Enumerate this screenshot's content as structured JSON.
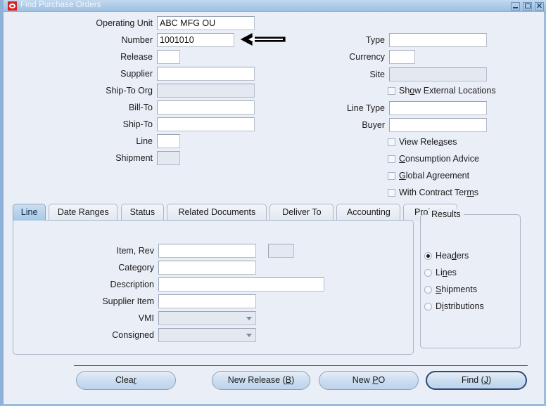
{
  "window": {
    "title": "Find Purchase Orders",
    "logo_icon": "oracle-logo-icon",
    "controls": {
      "minimize": "minimize-icon",
      "maximize": "maximize-icon",
      "close": "close-icon"
    }
  },
  "header_left_fields": [
    {
      "label": "Operating Unit",
      "value": "ABC MFG OU",
      "state": "enabled",
      "size": "wide"
    },
    {
      "label": "Number",
      "value": "1001010",
      "state": "enabled",
      "size": "medium"
    },
    {
      "label": "Release",
      "value": "",
      "state": "enabled",
      "size": "tiny"
    },
    {
      "label": "Supplier",
      "value": "",
      "state": "enabled",
      "size": "wide"
    },
    {
      "label": "Ship-To Org",
      "value": "",
      "state": "disabled",
      "size": "wide"
    },
    {
      "label": "Bill-To",
      "value": "",
      "state": "enabled",
      "size": "wide"
    },
    {
      "label": "Ship-To",
      "value": "",
      "state": "enabled",
      "size": "wide"
    },
    {
      "label": "Line",
      "value": "",
      "state": "enabled",
      "size": "tiny"
    },
    {
      "label": "Shipment",
      "value": "",
      "state": "disabled",
      "size": "tiny"
    }
  ],
  "header_right_fields": [
    {
      "label": "Type",
      "value": "",
      "state": "enabled",
      "size": "wide"
    },
    {
      "label": "Currency",
      "value": "",
      "state": "enabled",
      "size": "tiny"
    },
    {
      "label": "Site",
      "value": "",
      "state": "disabled",
      "size": "wide"
    },
    {
      "label": "Line Type",
      "value": "",
      "state": "enabled",
      "size": "wide"
    },
    {
      "label": "Buyer",
      "value": "",
      "state": "enabled",
      "size": "wide"
    }
  ],
  "header_checkboxes": [
    {
      "label_pre": "Sh",
      "accel": "o",
      "label_post": "w External Locations",
      "checked": false
    },
    {
      "label_pre": "View Rele",
      "accel": "a",
      "label_post": "ses",
      "checked": false
    },
    {
      "label_pre": "",
      "accel": "C",
      "label_post": "onsumption Advice",
      "checked": false
    },
    {
      "label_pre": "",
      "accel": "G",
      "label_post": "lobal Agreement",
      "checked": false
    },
    {
      "label_pre": "With Contract Ter",
      "accel": "m",
      "label_post": "s",
      "checked": false
    }
  ],
  "tabs": [
    {
      "label": "Line",
      "active": true
    },
    {
      "label": "Date Ranges",
      "active": false
    },
    {
      "label": "Status",
      "active": false
    },
    {
      "label": "Related Documents",
      "active": false
    },
    {
      "label": "Deliver To",
      "active": false
    },
    {
      "label": "Accounting",
      "active": false
    },
    {
      "label": "Projects",
      "active": false
    }
  ],
  "line_tab_fields": [
    {
      "label": "Item, Rev",
      "value": "",
      "state": "enabled",
      "kind": "text"
    },
    {
      "label": "Category",
      "value": "",
      "state": "enabled",
      "kind": "text"
    },
    {
      "label": "Description",
      "value": "",
      "state": "enabled",
      "kind": "text"
    },
    {
      "label": "Supplier Item",
      "value": "",
      "state": "enabled",
      "kind": "text"
    },
    {
      "label": "VMI",
      "value": "",
      "state": "disabled",
      "kind": "combo"
    },
    {
      "label": "Consigned",
      "value": "",
      "state": "disabled",
      "kind": "combo"
    }
  ],
  "line_tab_rev_field": {
    "value": "",
    "state": "disabled"
  },
  "results": {
    "legend": "Results",
    "options": [
      {
        "label_pre": "Hea",
        "accel": "d",
        "label_post": "ers",
        "selected": true
      },
      {
        "label_pre": "Li",
        "accel": "n",
        "label_post": "es",
        "selected": false
      },
      {
        "label_pre": "",
        "accel": "S",
        "label_post": "hipments",
        "selected": false
      },
      {
        "label_pre": "D",
        "accel": "i",
        "label_post": "stributions",
        "selected": false
      }
    ]
  },
  "buttons": [
    {
      "text_pre": "Clea",
      "accel": "r",
      "text_post": "",
      "default": false
    },
    {
      "text_pre": "New Release (",
      "accel": "B",
      "text_post": ")",
      "default": false
    },
    {
      "text_pre": "New ",
      "accel": "P",
      "text_post": "O",
      "default": false
    },
    {
      "text_pre": "Find (",
      "accel": "J",
      "text_post": ")",
      "default": true
    }
  ],
  "annotation": {
    "arrow_icon": "left-arrow-annotation-icon",
    "points_at": "Number",
    "color": "#000000"
  }
}
